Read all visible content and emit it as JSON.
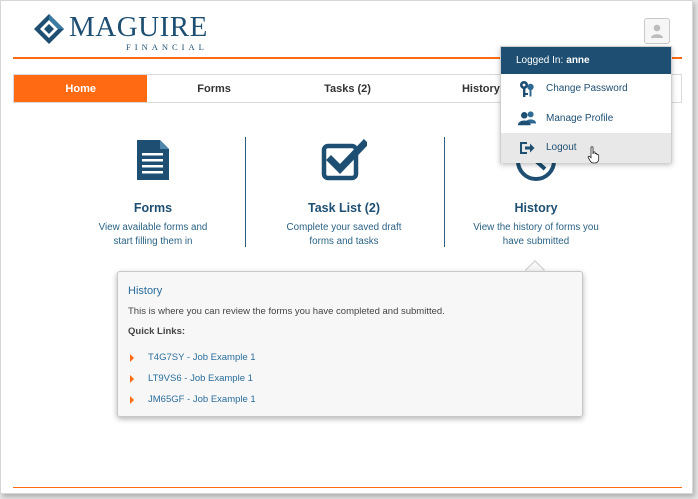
{
  "brand": {
    "name": "MAGUIRE",
    "sub": "FINANCIAL",
    "primary_color": "#1e4f72",
    "accent_color": "#ff6a13"
  },
  "nav": {
    "tabs": [
      {
        "label": "Home",
        "active": true
      },
      {
        "label": "Forms"
      },
      {
        "label": "Tasks (2)"
      },
      {
        "label": "History"
      },
      {
        "label": ""
      }
    ]
  },
  "features": {
    "forms": {
      "icon": "document-icon",
      "title": "Forms",
      "description": "View available forms and start filling them in"
    },
    "tasks": {
      "icon": "checkbox-icon",
      "title": "Task List (2)",
      "description": "Complete your saved draft forms and tasks"
    },
    "history": {
      "icon": "clock-icon",
      "title": "History",
      "description": "View the history of forms you have submitted"
    }
  },
  "history_popup": {
    "title": "History",
    "description": "This is where you can review the forms you have completed and submitted.",
    "quick_links_label": "Quick Links:",
    "links": [
      "T4G7SY - Job Example 1",
      "LT9VS6 - Job Example 1",
      "JM65GF - Job Example 1"
    ]
  },
  "user_menu": {
    "logged_in_label": "Logged In:",
    "username": "anne",
    "items": [
      {
        "label": "Change Password",
        "icon": "keys-icon"
      },
      {
        "label": "Manage Profile",
        "icon": "users-icon"
      },
      {
        "label": "Logout",
        "icon": "logout-icon",
        "hovered": true
      }
    ]
  }
}
